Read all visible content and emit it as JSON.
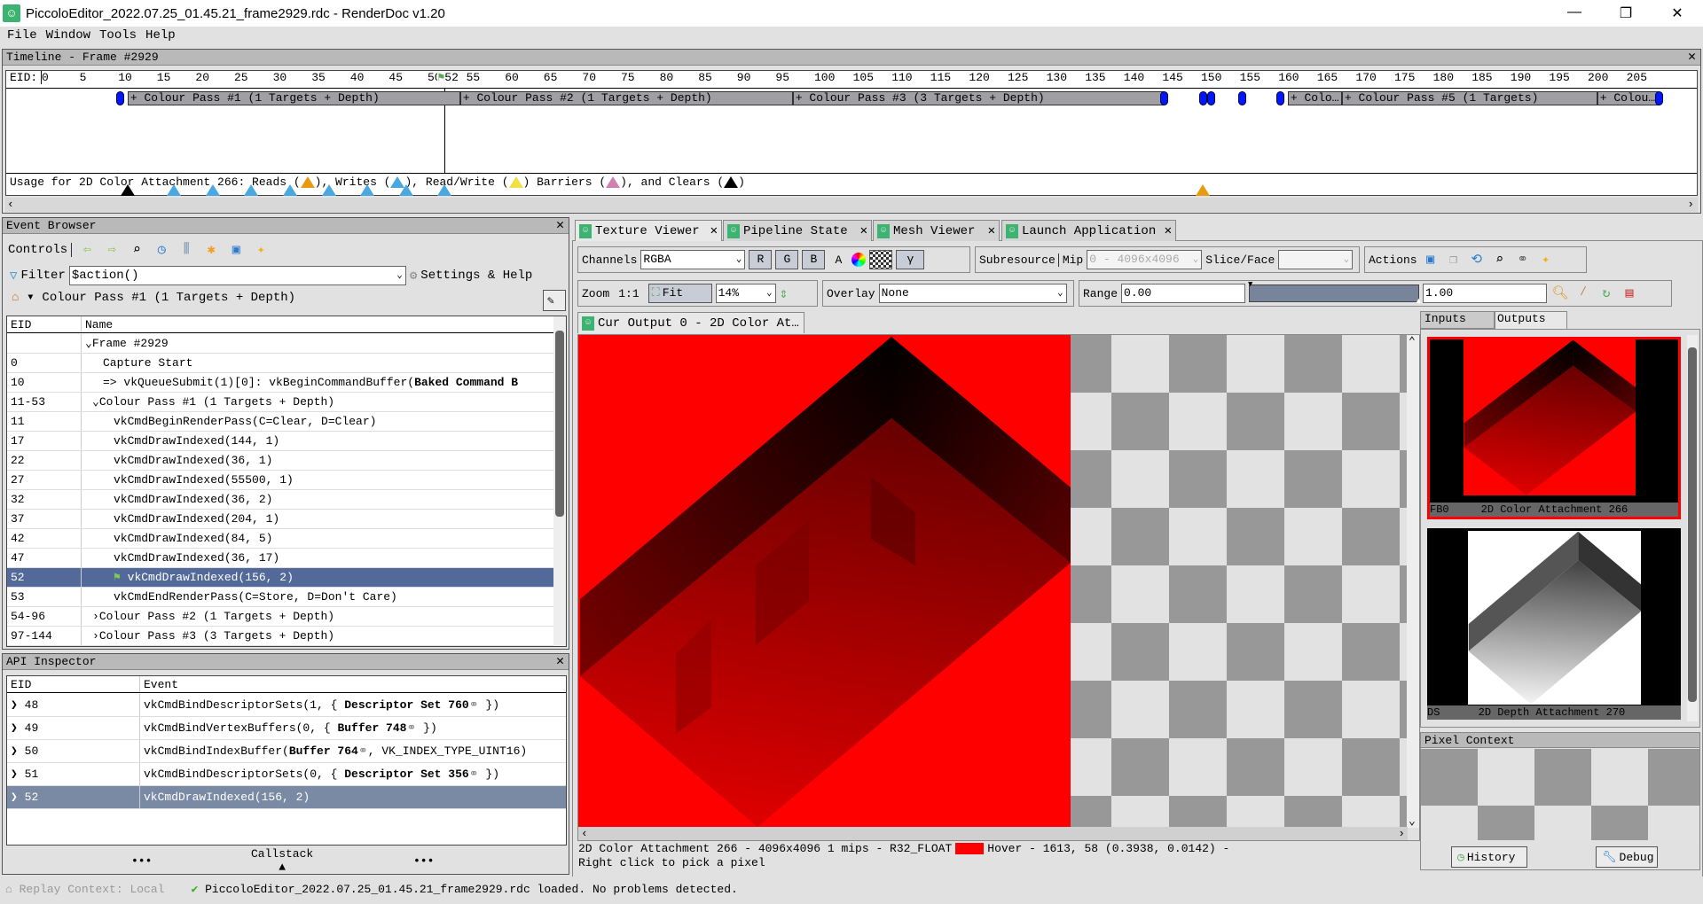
{
  "window": {
    "title": "PiccoloEditor_2022.07.25_01.45.21_frame2929.rdc - RenderDoc v1.20",
    "minimize": "—",
    "restore": "❐",
    "close": "✕"
  },
  "menu": [
    "File",
    "Window",
    "Tools",
    "Help"
  ],
  "timeline": {
    "title": "Timeline - Frame #2929",
    "eid_label": "EID:",
    "current_eid": 52,
    "current_label": "52",
    "max_eid": 205,
    "passes": [
      {
        "label": "+ Colour Pass #1 (1 Targets + Depth)",
        "start": 11,
        "end": 53
      },
      {
        "label": "+ Colour Pass #2 (1 Targets + Depth)",
        "start": 54,
        "end": 96
      },
      {
        "label": "+ Colour Pass #3 (3 Targets + Depth)",
        "start": 97,
        "end": 144
      },
      {
        "label": "+ Colo…",
        "start": 161,
        "end": 167
      },
      {
        "label": "+ Colour Pass #5 (1 Targets)",
        "start": 168,
        "end": 200
      },
      {
        "label": "+ Colou…",
        "start": 201,
        "end": 208
      }
    ],
    "markers": [
      10,
      145,
      150,
      151,
      155,
      160,
      209
    ],
    "usage": {
      "prefix": "Usage for 2D Color Attachment 266: Reads (",
      "reads": "), Writes (",
      "writes": "), Read/Write (",
      "rw": ") Barriers (",
      "barriers": "), and Clears (",
      "end": ")",
      "clears": [
        11
      ],
      "write_eids": [
        17,
        22,
        27,
        32,
        37,
        42,
        47,
        52
      ],
      "read_eids": [
        150
      ]
    },
    "colors": {
      "read": "#e89a10",
      "write": "#4aa8e0",
      "readwrite": "#f0e040",
      "barrier": "#d080b0",
      "clear": "#000000",
      "marker": "#0016ff"
    }
  },
  "event_browser": {
    "title": "Event Browser",
    "controls": "Controls",
    "filter_label": "Filter",
    "filter_value": "$action()",
    "settings": "Settings & Help",
    "breadcrumb": "Colour Pass #1 (1 Targets + Depth)",
    "columns": [
      "EID",
      "Name"
    ],
    "rows": [
      {
        "eid": "",
        "name": "Frame #2929",
        "indent": 0,
        "exp": "⌄"
      },
      {
        "eid": "0",
        "name": "Capture Start",
        "indent": 1
      },
      {
        "eid": "10",
        "name": "=>  vkQueueSubmit(1)[0]:  vkBeginCommandBuffer(",
        "bold": "Baked Command B",
        "indent": 1
      },
      {
        "eid": "11-53",
        "name": "Colour Pass #1 (1 Targets + Depth)",
        "indent": 1,
        "exp": "⌄"
      },
      {
        "eid": "11",
        "name": "vkCmdBeginRenderPass(C=Clear, D=Clear)",
        "indent": 2
      },
      {
        "eid": "17",
        "name": "vkCmdDrawIndexed(144, 1)",
        "indent": 2
      },
      {
        "eid": "22",
        "name": "vkCmdDrawIndexed(36, 1)",
        "indent": 2
      },
      {
        "eid": "27",
        "name": "vkCmdDrawIndexed(55500, 1)",
        "indent": 2
      },
      {
        "eid": "32",
        "name": "vkCmdDrawIndexed(36, 2)",
        "indent": 2
      },
      {
        "eid": "37",
        "name": "vkCmdDrawIndexed(204, 1)",
        "indent": 2
      },
      {
        "eid": "42",
        "name": "vkCmdDrawIndexed(84, 5)",
        "indent": 2
      },
      {
        "eid": "47",
        "name": "vkCmdDrawIndexed(36, 17)",
        "indent": 2
      },
      {
        "eid": "52",
        "name": "vkCmdDrawIndexed(156, 2)",
        "indent": 2,
        "selected": true
      },
      {
        "eid": "53",
        "name": "vkCmdEndRenderPass(C=Store, D=Don't Care)",
        "indent": 2
      },
      {
        "eid": "54-96",
        "name": "Colour Pass #2 (1 Targets + Depth)",
        "indent": 1,
        "exp": "›"
      },
      {
        "eid": "97-144",
        "name": "Colour Pass #3 (3 Targets + Depth)",
        "indent": 1,
        "exp": "›"
      }
    ]
  },
  "api_inspector": {
    "title": "API Inspector",
    "columns": [
      "EID",
      "Event"
    ],
    "rows": [
      {
        "eid": "48",
        "pre": "vkCmdBindDescriptorSets(1,  {  ",
        "bold": "Descriptor Set 760",
        "post": "  })"
      },
      {
        "eid": "49",
        "pre": "vkCmdBindVertexBuffers(0,  {  ",
        "bold": "Buffer 748",
        "post": "  })"
      },
      {
        "eid": "50",
        "pre": "vkCmdBindIndexBuffer(",
        "bold": "Buffer 764",
        "post": ",  VK_INDEX_TYPE_UINT16)"
      },
      {
        "eid": "51",
        "pre": "vkCmdBindDescriptorSets(0,  {  ",
        "bold": "Descriptor Set 356",
        "post": "  })"
      },
      {
        "eid": "52",
        "pre": "vkCmdDrawIndexed(156, 2)",
        "bold": "",
        "post": "",
        "selected": true
      }
    ],
    "callstack": "Callstack",
    "dots": "•••"
  },
  "tabs": [
    "Texture Viewer",
    "Pipeline State",
    "Mesh Viewer",
    "Launch Application"
  ],
  "texture_viewer": {
    "channels_label": "Channels",
    "channels": "RGBA",
    "r": "R",
    "g": "G",
    "b": "B",
    "a": "A",
    "gamma": "γ",
    "subresource": "Subresource",
    "mip_label": "Mip",
    "mip": "0 - 4096x4096",
    "slice_label": "Slice/Face",
    "slice": "",
    "actions": "Actions",
    "zoom_label": "Zoom",
    "one_to_one": "1:1",
    "fit": "Fit",
    "zoom": "14%",
    "overlay_label": "Overlay",
    "overlay": "None",
    "range_label": "Range",
    "range_min": "0.00",
    "range_max": "1.00",
    "output_tab": "Cur Output 0 - 2D Color At…",
    "status_line": "2D Color Attachment 266 - 4096x4096 1 mips - R32_FLOAT",
    "hover": "Hover -   1613,    58 (0.3938, 0.0142)   -",
    "hint": "Right click to pick a pixel",
    "pick_color": "#ff0000"
  },
  "side": {
    "inputs": "Inputs",
    "outputs": "Outputs",
    "thumbs": [
      {
        "slot": "FB0",
        "name": "2D Color Attachment 266"
      },
      {
        "slot": "DS",
        "name": "2D Depth Attachment 270"
      }
    ],
    "pixel_context": "Pixel Context",
    "history": "History",
    "debug": "Debug"
  },
  "status": {
    "replay": "Replay Context: Local",
    "message": "PiccoloEditor_2022.07.25_01.45.21_frame2929.rdc loaded. No problems detected."
  }
}
